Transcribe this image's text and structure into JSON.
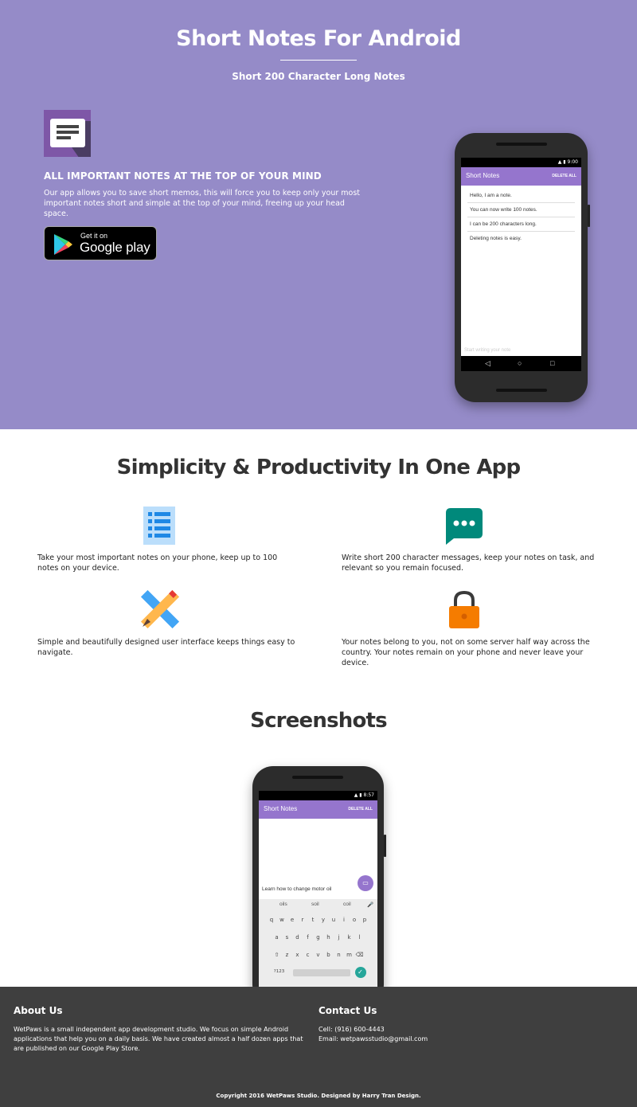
{
  "hero": {
    "title": "Short Notes For Android",
    "subtitle": "Short 200 Character Long Notes",
    "heading": "ALL IMPORTANT NOTES AT THE TOP OF YOUR MIND",
    "text": "Our app allows you to save short memos, this will force you to keep only your most important notes short and simple at the top of your mind, freeing up your head space.",
    "badge_small": "Get it on",
    "badge_big": "Google play"
  },
  "phone1": {
    "time": "9:00",
    "app_title": "Short Notes",
    "action": "DELETE ALL",
    "notes": [
      "Hello, I am a note.",
      "You can now write 100 notes.",
      "I can be 200 characters long.",
      "Deleting notes is easy."
    ],
    "input_placeholder": "Start writing your note"
  },
  "features": {
    "title": "Simplicity & Productivity In One App",
    "items": [
      {
        "icon": "list-icon",
        "text": "Take your most important notes on your phone, keep up to 100 notes on your device."
      },
      {
        "icon": "chat-icon",
        "text": "Write short 200 character messages, keep your notes on task, and relevant so you remain focused."
      },
      {
        "icon": "pencil-ruler-icon",
        "text": "Simple and beautifully designed user interface keeps things easy to navigate."
      },
      {
        "icon": "lock-icon",
        "text": "Your notes belong to you, not on some server half way across the country. Your notes remain on your phone and never leave your device."
      }
    ]
  },
  "screenshots": {
    "title": "Screenshots",
    "time": "8:57",
    "app_title": "Short Notes",
    "action": "DELETE ALL",
    "typed": "Learn how to change motor oil",
    "suggestions": [
      "oils",
      "soil",
      "coil"
    ],
    "row1": [
      "q",
      "w",
      "e",
      "r",
      "t",
      "y",
      "u",
      "i",
      "o",
      "p"
    ],
    "row2": [
      "a",
      "s",
      "d",
      "f",
      "g",
      "h",
      "j",
      "k",
      "l"
    ],
    "row3": [
      "z",
      "x",
      "c",
      "v",
      "b",
      "n",
      "m"
    ],
    "symbols_key": "?123"
  },
  "footer": {
    "about_title": "About Us",
    "about_text": "WetPaws is a small independent app development studio. We focus on simple Android applications that help you on a daily basis. We have created almost a half dozen apps that are published on our Google Play Store.",
    "contact_title": "Contact Us",
    "cell": "Cell: (916) 600-4443",
    "email": "Email: wetpawsstudio@gmail.com",
    "copyright": "Copyright 2016 WetPaws Studio. Designed by Harry Tran Design."
  },
  "colors": {
    "hero_bg": "#958bc8",
    "appbar": "#9575cd",
    "footer_bg": "#3f3f3f",
    "list_icon": "#64b5f6",
    "chat_icon": "#00897b",
    "lock_icon": "#f57c00"
  }
}
